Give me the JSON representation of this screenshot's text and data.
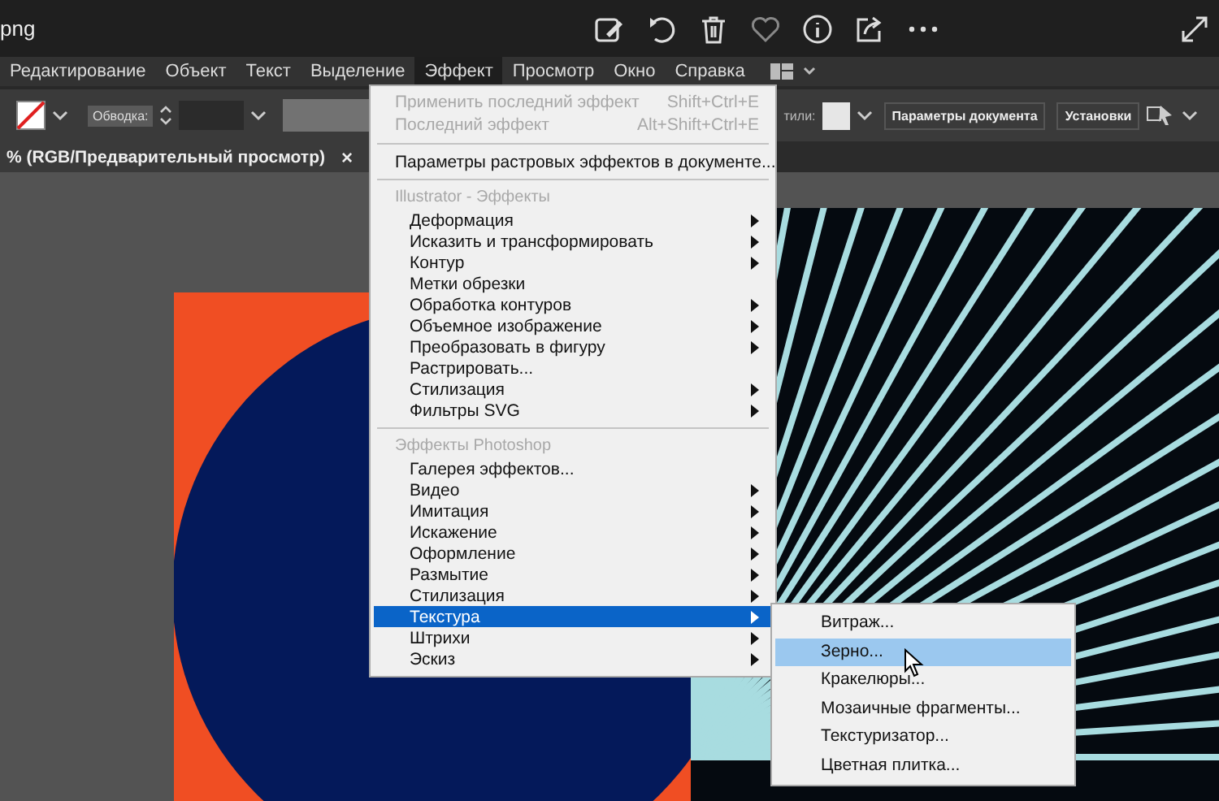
{
  "viewer": {
    "file_name": "png"
  },
  "menu_bar": {
    "items": [
      {
        "label": "Редактирование",
        "selected": false
      },
      {
        "label": "Объект",
        "selected": false
      },
      {
        "label": "Текст",
        "selected": false
      },
      {
        "label": "Выделение",
        "selected": false
      },
      {
        "label": "Эффект",
        "selected": true
      },
      {
        "label": "Просмотр",
        "selected": false
      },
      {
        "label": "Окно",
        "selected": false
      },
      {
        "label": "Справка",
        "selected": false
      }
    ]
  },
  "control_bar": {
    "stroke_label": "Обводка:",
    "styles_label": "тили:",
    "buttons": [
      "Параметры документа",
      "Установки"
    ]
  },
  "document_tab": {
    "title": "% (RGB/Предварительный просмотр)",
    "close": "×"
  },
  "effect_menu": {
    "sections": [
      {
        "items": [
          {
            "label": "Применить последний эффект",
            "shortcut": "Shift+Ctrl+E",
            "disabled": true,
            "submenu": false,
            "selected": false
          },
          {
            "label": "Последний эффект",
            "shortcut": "Alt+Shift+Ctrl+E",
            "disabled": true,
            "submenu": false,
            "selected": false
          }
        ]
      },
      {
        "items": [
          {
            "label": "Параметры растровых эффектов в документе...",
            "disabled": false,
            "submenu": false,
            "selected": false
          }
        ]
      },
      {
        "header": "Illustrator - Эффекты",
        "items": [
          {
            "label": "Деформация",
            "disabled": false,
            "submenu": true,
            "selected": false
          },
          {
            "label": "Исказить и трансформировать",
            "disabled": false,
            "submenu": true,
            "selected": false
          },
          {
            "label": "Контур",
            "disabled": false,
            "submenu": true,
            "selected": false
          },
          {
            "label": "Метки обрезки",
            "disabled": false,
            "submenu": false,
            "selected": false
          },
          {
            "label": "Обработка контуров",
            "disabled": false,
            "submenu": true,
            "selected": false
          },
          {
            "label": "Объемное изображение",
            "disabled": false,
            "submenu": true,
            "selected": false
          },
          {
            "label": "Преобразовать в фигуру",
            "disabled": false,
            "submenu": true,
            "selected": false
          },
          {
            "label": "Растрировать...",
            "disabled": false,
            "submenu": false,
            "selected": false
          },
          {
            "label": "Стилизация",
            "disabled": false,
            "submenu": true,
            "selected": false
          },
          {
            "label": "Фильтры SVG",
            "disabled": false,
            "submenu": true,
            "selected": false
          }
        ]
      },
      {
        "header": "Эффекты Photoshop",
        "items": [
          {
            "label": "Галерея эффектов...",
            "disabled": false,
            "submenu": false,
            "selected": false
          },
          {
            "label": "Видео",
            "disabled": false,
            "submenu": true,
            "selected": false
          },
          {
            "label": "Имитация",
            "disabled": false,
            "submenu": true,
            "selected": false
          },
          {
            "label": "Искажение",
            "disabled": false,
            "submenu": true,
            "selected": false
          },
          {
            "label": "Оформление",
            "disabled": false,
            "submenu": true,
            "selected": false
          },
          {
            "label": "Размытие",
            "disabled": false,
            "submenu": true,
            "selected": false
          },
          {
            "label": "Стилизация",
            "disabled": false,
            "submenu": true,
            "selected": false
          },
          {
            "label": "Текстура",
            "disabled": false,
            "submenu": true,
            "selected": true
          },
          {
            "label": "Штрихи",
            "disabled": false,
            "submenu": true,
            "selected": false
          },
          {
            "label": "Эскиз",
            "disabled": false,
            "submenu": true,
            "selected": false
          }
        ]
      }
    ]
  },
  "texture_submenu": {
    "items": [
      {
        "label": "Витраж...",
        "selected": false
      },
      {
        "label": "Зерно...",
        "selected": true
      },
      {
        "label": "Кракелюры...",
        "selected": false
      },
      {
        "label": "Мозаичные фрагменты...",
        "selected": false
      },
      {
        "label": "Текстуризатор...",
        "selected": false
      },
      {
        "label": "Цветная плитка...",
        "selected": false
      }
    ]
  }
}
